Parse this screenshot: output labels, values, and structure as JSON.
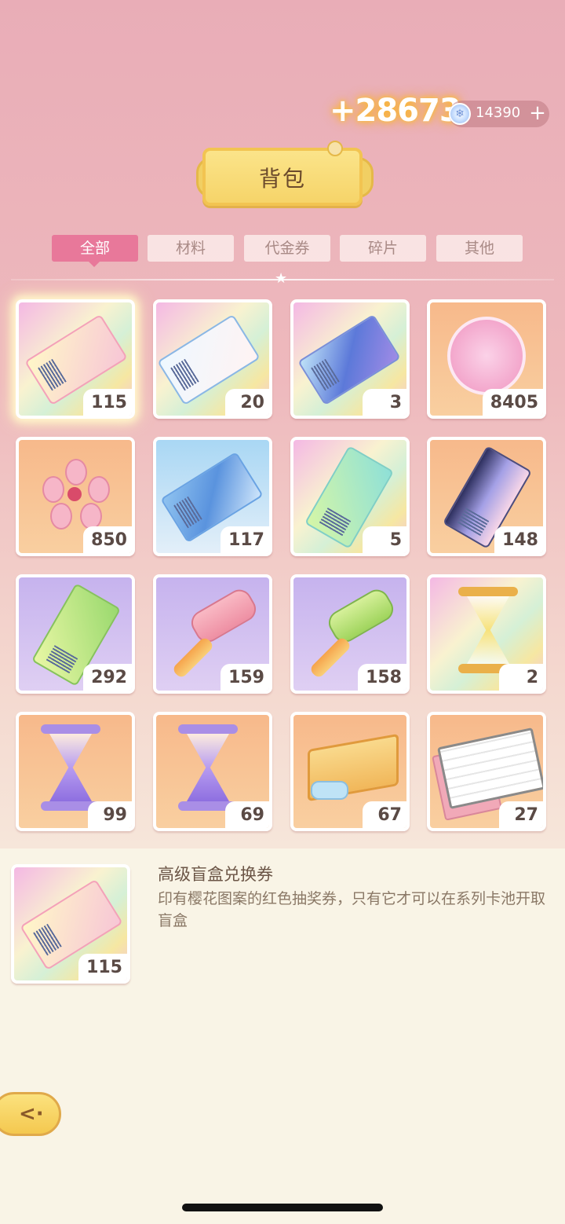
{
  "header": {
    "gold_bonus": "+28673",
    "gem_count": "14390",
    "gem_plus": "+",
    "title": "背包"
  },
  "tabs": [
    {
      "label": "全部",
      "active": true
    },
    {
      "label": "材料",
      "active": false
    },
    {
      "label": "代金券",
      "active": false
    },
    {
      "label": "碎片",
      "active": false
    },
    {
      "label": "其他",
      "active": false
    }
  ],
  "items": [
    {
      "icon": "premium-blind-box-ticket-icon",
      "count": "115",
      "selected": true
    },
    {
      "icon": "avatar-ticket-icon",
      "count": "20"
    },
    {
      "icon": "mystery-ticket-icon",
      "count": "3"
    },
    {
      "icon": "bag-coin-icon",
      "count": "8405"
    },
    {
      "icon": "sakura-flower-icon",
      "count": "850"
    },
    {
      "icon": "blue-ticket-icon",
      "count": "117"
    },
    {
      "icon": "video-ticket-icon",
      "count": "5"
    },
    {
      "icon": "dark-bag-ticket-icon",
      "count": "148"
    },
    {
      "icon": "green-bag-ticket-icon",
      "count": "292"
    },
    {
      "icon": "pink-paint-roller-icon",
      "count": "159"
    },
    {
      "icon": "green-paint-roller-icon",
      "count": "158"
    },
    {
      "icon": "golden-hourglass-icon",
      "count": "2"
    },
    {
      "icon": "purple-hourglass-icon",
      "count": "99"
    },
    {
      "icon": "purple-hourglass-icon",
      "count": "69"
    },
    {
      "icon": "gift-chest-icon",
      "count": "67"
    },
    {
      "icon": "comic-book-icon",
      "count": "27"
    }
  ],
  "detail": {
    "title": "高级盲盒兑换券",
    "description": "印有樱花图案的红色抽奖券，只有它才可以在系列卡池开取盲盒",
    "count": "115"
  },
  "colors": {
    "accent_pink": "#e8789a",
    "gold": "#f4c84f",
    "text_brown": "#6b5546"
  }
}
